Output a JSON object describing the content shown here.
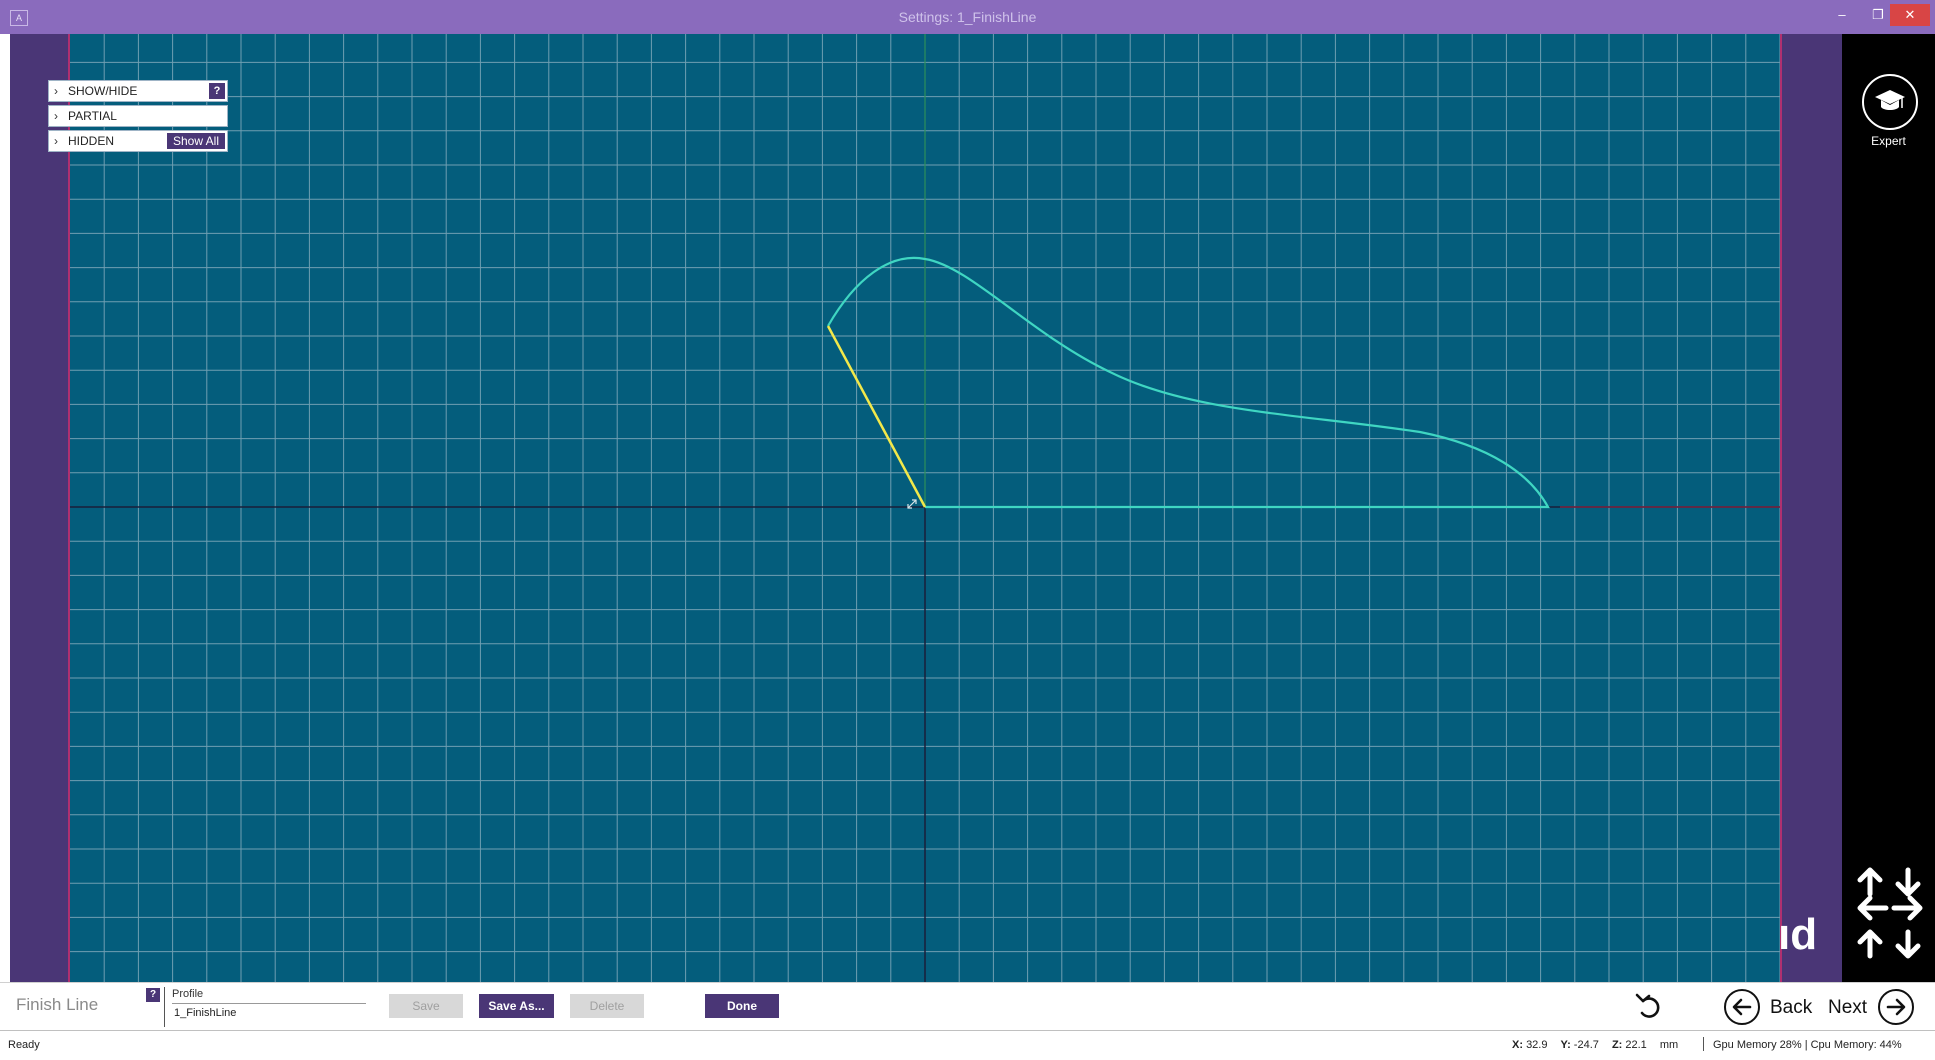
{
  "window": {
    "title": "Settings: 1_FinishLine",
    "icon_glyph": "A",
    "controls": [
      "–",
      "❐",
      "✕"
    ]
  },
  "panel": {
    "items": [
      {
        "label": "SHOW/HIDE",
        "extra": "?"
      },
      {
        "label": "PARTIAL",
        "extra": ""
      },
      {
        "label": "HIDDEN",
        "extra": "Show All"
      }
    ]
  },
  "viewport": {
    "watermark_text": "ıd",
    "background_color": "#045d7c",
    "grid_color": "#6f9fb2",
    "curve_color": "#3fd6c2",
    "highlight_color": "#f2e84a"
  },
  "sidebar": {
    "expert_label": "Expert",
    "expert_icon": "graduation-cap-icon",
    "pan_icon": "pan-arrows-icon"
  },
  "toolbar": {
    "title": "Finish Line",
    "help": "?",
    "profile_label": "Profile",
    "profile_value": "1_FinishLine",
    "save": "Save",
    "save_as": "Save As...",
    "delete": "Delete",
    "done": "Done",
    "back": "Back",
    "next": "Next"
  },
  "status": {
    "state": "Ready",
    "x_label": "X:",
    "x": "32.9",
    "y_label": "Y:",
    "y": "-24.7",
    "z_label": "Z:",
    "z": "22.1",
    "unit": "mm",
    "memory": "Gpu Memory 28% | Cpu Memory: 44%"
  }
}
